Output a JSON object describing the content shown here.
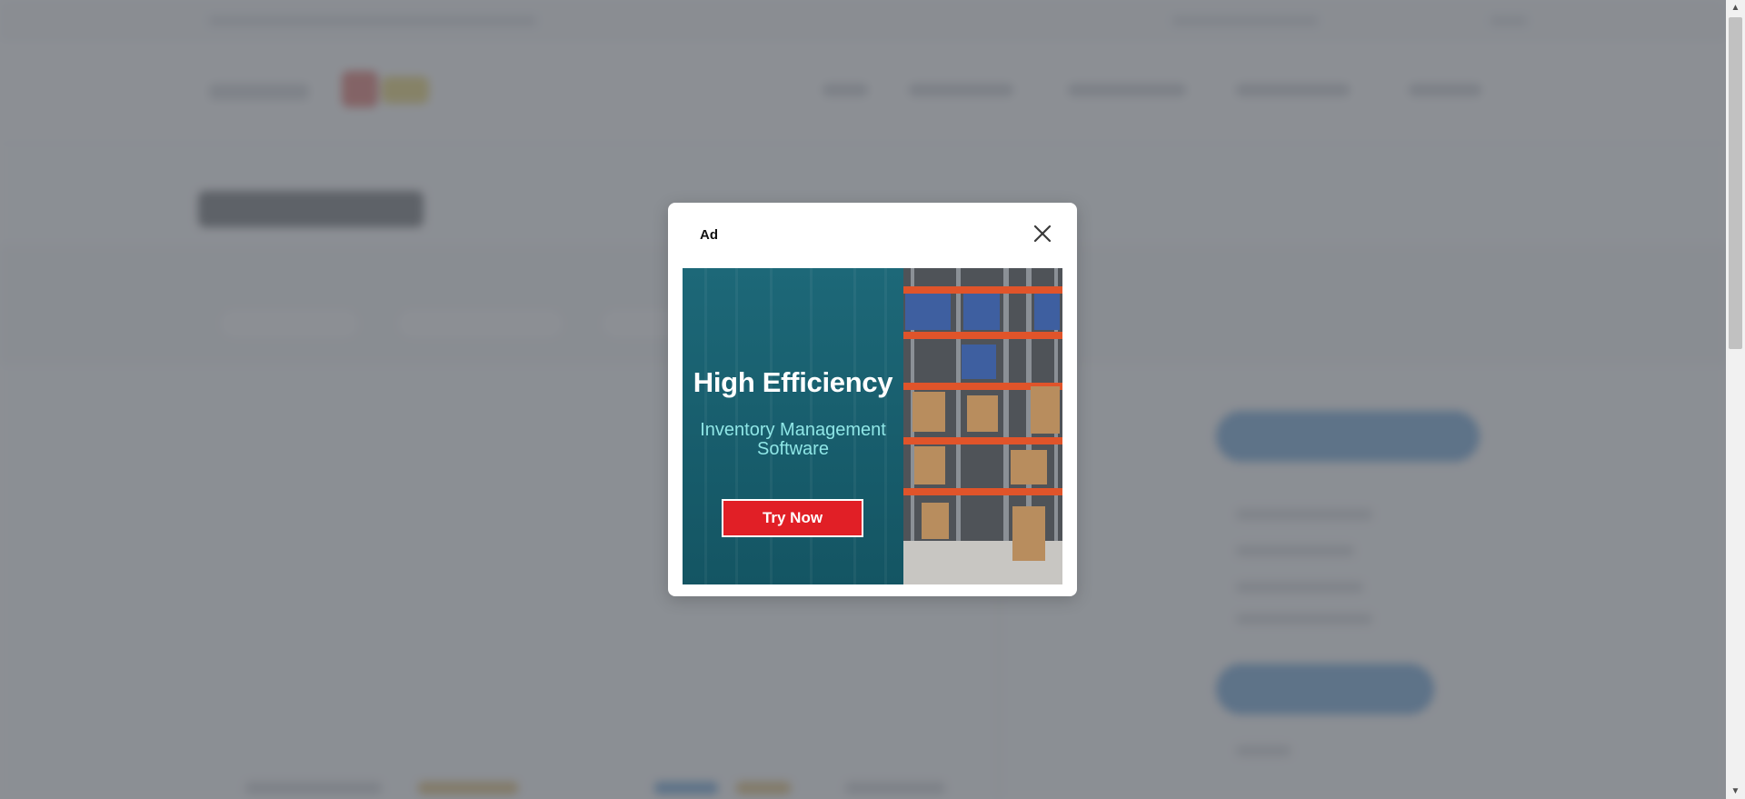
{
  "modal": {
    "ad_label": "Ad",
    "close_icon": "close-icon"
  },
  "ad": {
    "title": "High Efficiency",
    "subtitle_line1": "Inventory Management",
    "subtitle_line2": "Software",
    "cta_label": "Try Now",
    "image": "warehouse-shelves-photo"
  },
  "colors": {
    "accent_red": "#e11f26",
    "ad_background": "#19606f",
    "subtitle_teal": "#8fe6e6",
    "overlay": "#6c7076"
  }
}
